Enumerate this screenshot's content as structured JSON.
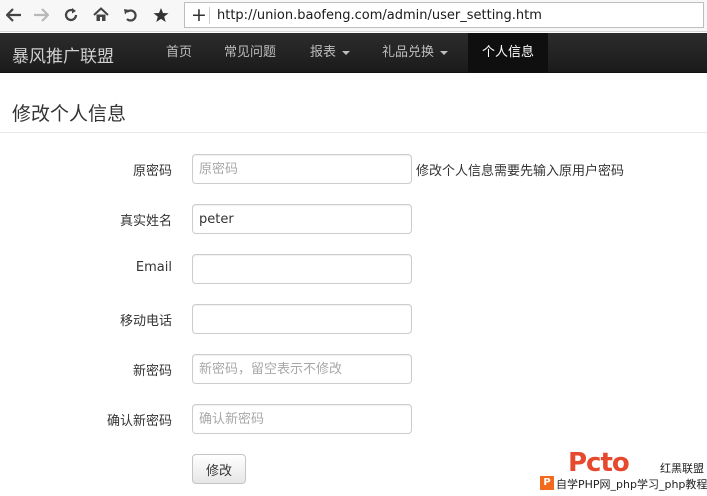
{
  "browser": {
    "url": "http://union.baofeng.com/admin/user_setting.htm",
    "plus": "+"
  },
  "navbar": {
    "brand": "暴风推广联盟",
    "items": [
      {
        "label": "首页"
      },
      {
        "label": "常见问题"
      },
      {
        "label": "报表"
      },
      {
        "label": "礼品兑换"
      },
      {
        "label": "个人信息"
      }
    ]
  },
  "page": {
    "title": "修改个人信息"
  },
  "form": {
    "old_password": {
      "label": "原密码",
      "value": "",
      "placeholder": "原密码",
      "help": "修改个人信息需要先输入原用户密码"
    },
    "real_name": {
      "label": "真实姓名",
      "value": "peter",
      "placeholder": ""
    },
    "email": {
      "label": "Email",
      "value": "",
      "placeholder": ""
    },
    "mobile": {
      "label": "移动电话",
      "value": "",
      "placeholder": ""
    },
    "new_password": {
      "label": "新密码",
      "value": "",
      "placeholder": "新密码，留空表示不修改"
    },
    "confirm_password": {
      "label": "确认新密码",
      "value": "",
      "placeholder": "确认新密码"
    },
    "submit_label": "修改"
  },
  "watermark": {
    "big": "Pcto",
    "side": "红黑联盟",
    "logo": "P",
    "text": "自学PHP网_php学习_php教程"
  },
  "icons": [
    "back-icon",
    "forward-icon",
    "reload-icon",
    "home-icon",
    "undo-icon",
    "star-icon"
  ]
}
